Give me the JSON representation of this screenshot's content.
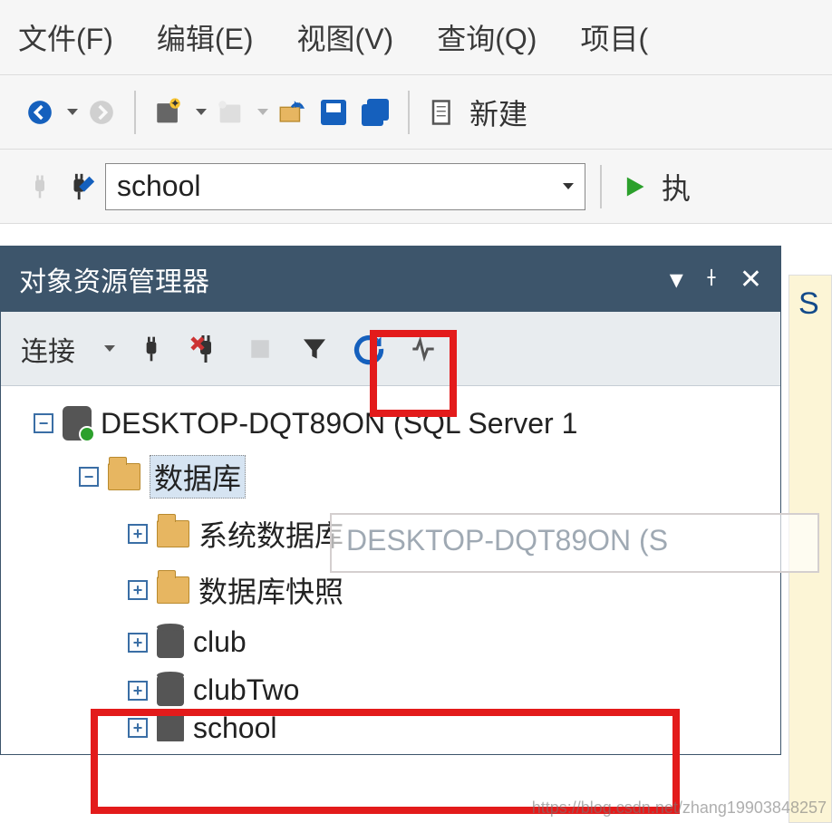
{
  "menu": {
    "file": "文件(F)",
    "edit": "编辑(E)",
    "view": "视图(V)",
    "query": "查询(Q)",
    "project": "项目("
  },
  "toolbar1": {
    "new_label": "新建"
  },
  "toolbar2": {
    "db_selected": "school",
    "execute_hint": "执"
  },
  "panel": {
    "title": "对象资源管理器",
    "connect": "连接"
  },
  "tree": {
    "server": "DESKTOP-DQT89ON (SQL Server 1",
    "databases": "数据库",
    "sysdb": "系统数据库",
    "snapshots": "数据库快照",
    "club": "club",
    "clubTwo": "clubTwo",
    "school": "school"
  },
  "tooltip": "DESKTOP-DQT89ON (S",
  "right_strip": "S",
  "watermark": "https://blog.csdn.net/zhang19903848257"
}
